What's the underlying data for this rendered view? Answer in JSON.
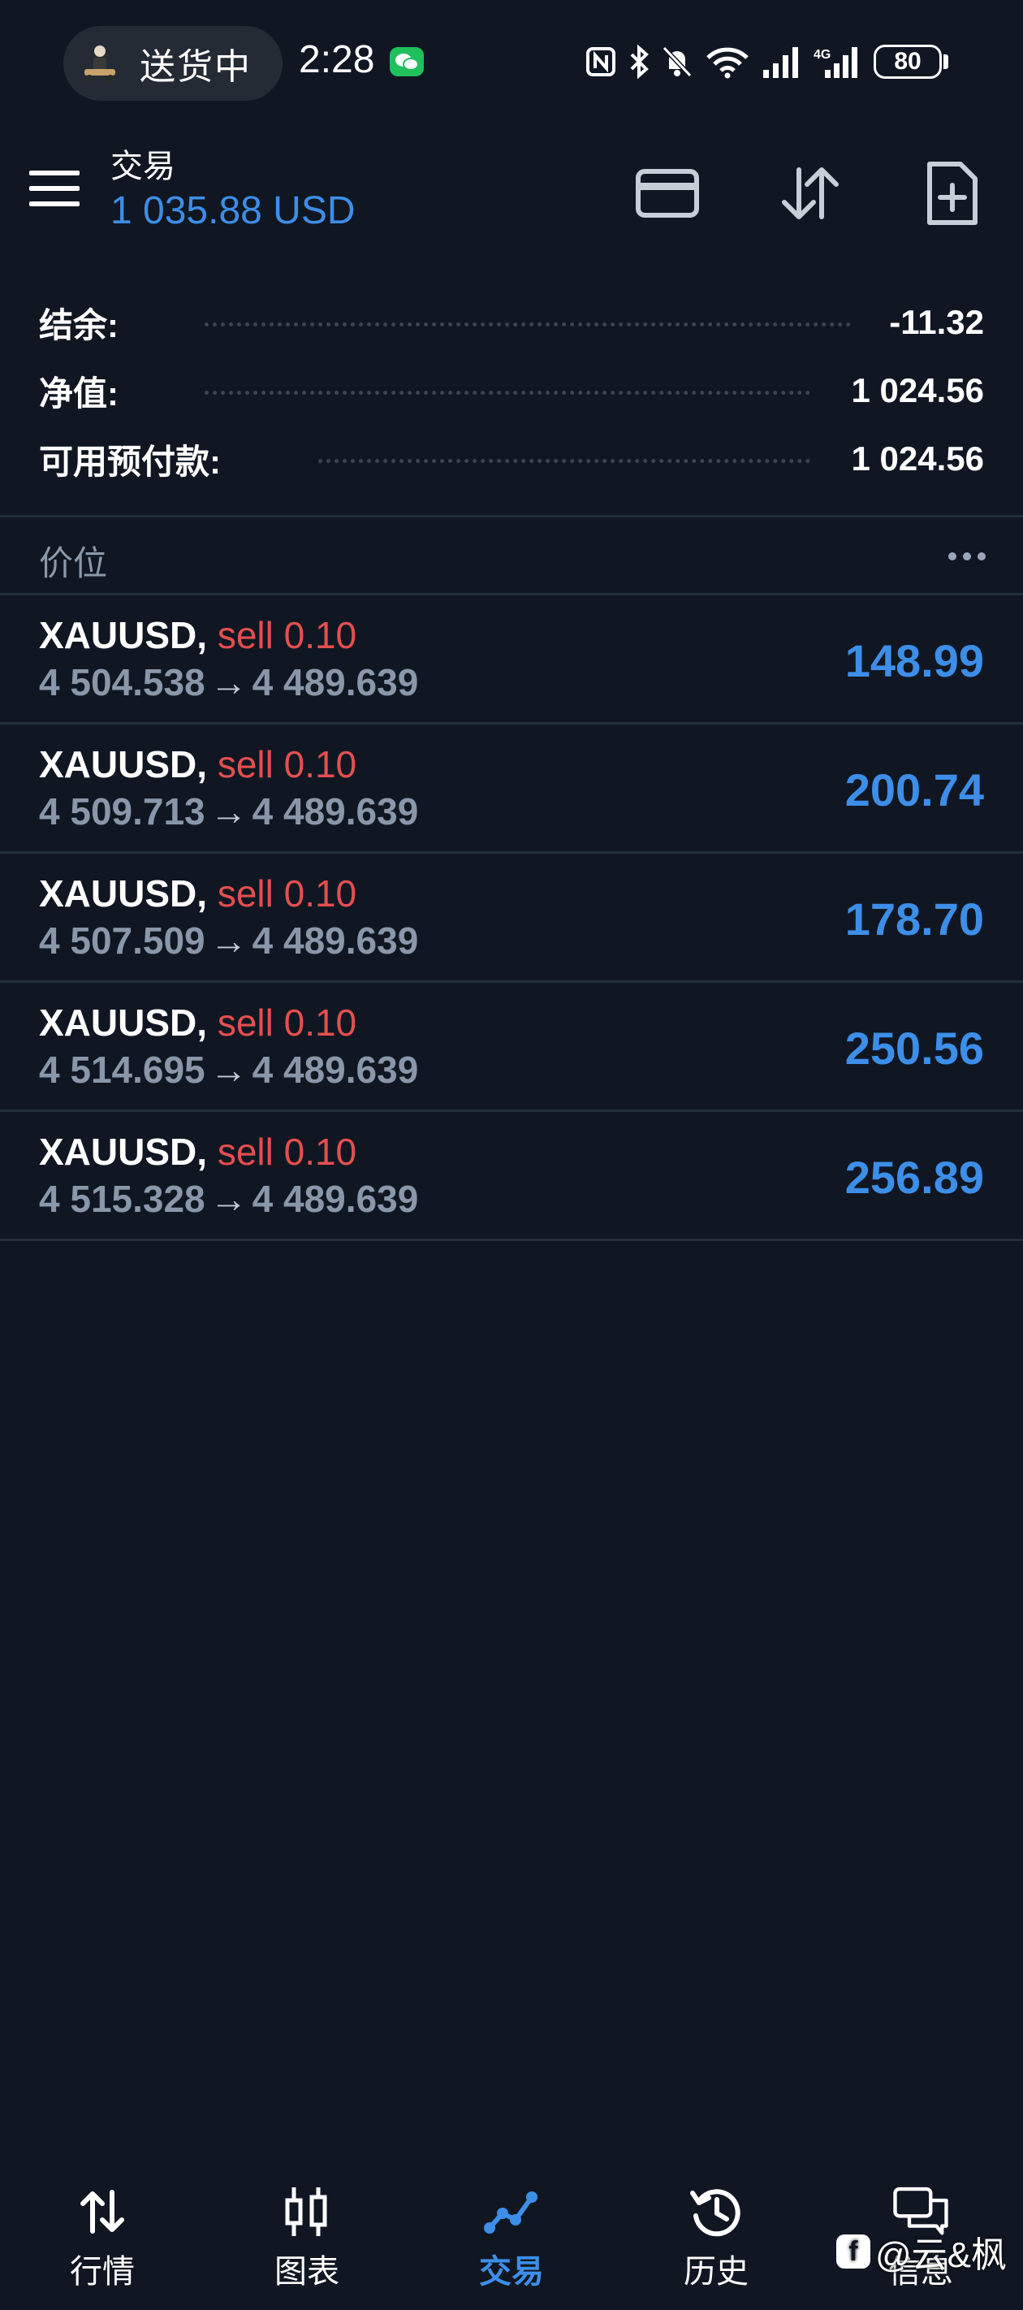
{
  "status_bar": {
    "delivery_text": "送货中",
    "time": "2:28",
    "battery": "80",
    "network": "4G"
  },
  "header": {
    "title": "交易",
    "balance": "1 035.88 USD"
  },
  "summary": [
    {
      "label": "结余:",
      "value": "-11.32"
    },
    {
      "label": "净值:",
      "value": "1 024.56"
    },
    {
      "label": "可用预付款:",
      "value": "1 024.56"
    }
  ],
  "section": {
    "title": "价位"
  },
  "positions": [
    {
      "symbol": "XAUUSD,",
      "side": "sell 0.10",
      "open": "4 504.538",
      "current": "4 489.639",
      "arrow": "→",
      "profit": "148.99"
    },
    {
      "symbol": "XAUUSD,",
      "side": "sell 0.10",
      "open": "4 509.713",
      "current": "4 489.639",
      "arrow": "→",
      "profit": "200.74"
    },
    {
      "symbol": "XAUUSD,",
      "side": "sell 0.10",
      "open": "4 507.509",
      "current": "4 489.639",
      "arrow": "→",
      "profit": "178.70"
    },
    {
      "symbol": "XAUUSD,",
      "side": "sell 0.10",
      "open": "4 514.695",
      "current": "4 489.639",
      "arrow": "→",
      "profit": "250.56"
    },
    {
      "symbol": "XAUUSD,",
      "side": "sell 0.10",
      "open": "4 515.328",
      "current": "4 489.639",
      "arrow": "→",
      "profit": "256.89"
    }
  ],
  "nav": [
    {
      "label": "行情",
      "icon": "quotes-icon"
    },
    {
      "label": "图表",
      "icon": "chart-icon"
    },
    {
      "label": "交易",
      "icon": "trade-icon",
      "active": true
    },
    {
      "label": "历史",
      "icon": "history-icon"
    },
    {
      "label": "信息",
      "icon": "messages-icon"
    }
  ],
  "watermark": {
    "text": "@云&枫"
  },
  "colors": {
    "background": "#101722",
    "accent": "#3d8ee8",
    "sell": "#e54f4f",
    "muted": "#8a96a9"
  }
}
